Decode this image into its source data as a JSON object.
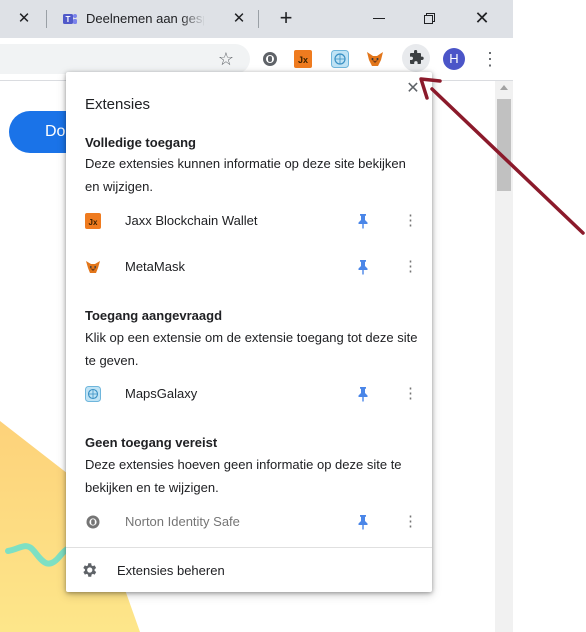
{
  "tabs": [
    {
      "title": "",
      "close": "✕"
    },
    {
      "title": "Deelnemen aan gesprek",
      "close": "✕"
    }
  ],
  "new_tab": "+",
  "window": {
    "minimize": "",
    "close": "✕"
  },
  "toolbar": {
    "star": "☆",
    "extensions_icon_names": [
      "norton-icon",
      "jaxx-icon",
      "mapsgalaxy-icon",
      "metamask-icon",
      "puzzle-icon"
    ],
    "profile_initial": "H",
    "menu": "⋮"
  },
  "page": {
    "button_text": "Do"
  },
  "popup": {
    "title": "Extensies",
    "close": "✕",
    "sections": [
      {
        "title": "Volledige toegang",
        "description": "Deze extensies kunnen informatie op deze site bekijken en wijzigen.",
        "items": [
          {
            "name": "Jaxx Blockchain Wallet",
            "icon": "jaxx-icon",
            "pinned": true
          },
          {
            "name": "MetaMask",
            "icon": "metamask-icon",
            "pinned": true
          }
        ]
      },
      {
        "title": "Toegang aangevraagd",
        "description": "Klik op een extensie om de extensie toegang tot deze site te geven.",
        "items": [
          {
            "name": "MapsGalaxy",
            "icon": "mapsgalaxy-icon",
            "pinned": true
          }
        ]
      },
      {
        "title": "Geen toegang vereist",
        "description": "Deze extensies hoeven geen informatie op deze site te bekijken en te wijzigen.",
        "items": [
          {
            "name": "Norton Identity Safe",
            "icon": "norton-icon",
            "pinned": true
          }
        ]
      }
    ],
    "more": "⋮",
    "manage_label": "Extensies beheren"
  },
  "colors": {
    "tabstrip": "#dee1e6",
    "accent": "#1a73e8",
    "pin": "#4a86e8",
    "avatar": "#4b55c8",
    "arrow": "#8b1a2b"
  }
}
